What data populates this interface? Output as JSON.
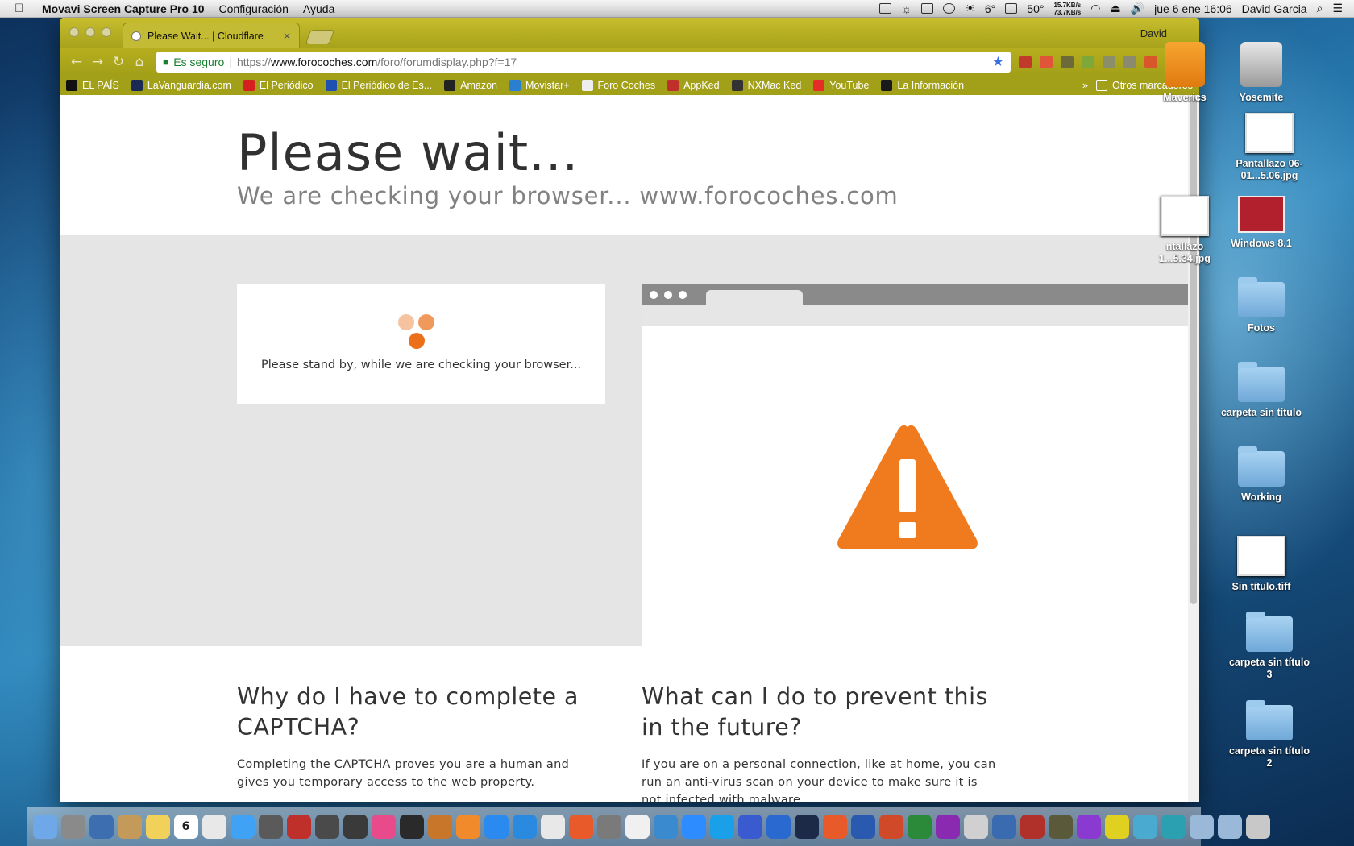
{
  "menubar": {
    "app_name": "Movavi Screen Capture Pro 10",
    "menus": [
      "Configuración",
      "Ayuda"
    ],
    "temperature": "6°",
    "cpu_temp": "50°",
    "net_up": "15.7KB/s",
    "net_down": "73.7KB/s",
    "datetime": "jue 6 ene  16:06",
    "user": "David Garcia"
  },
  "browser": {
    "tab_title": "Please Wait... | Cloudflare",
    "profile": "David",
    "security_label": "Es seguro",
    "url_scheme": "https://",
    "url_host": "www.forocoches.com",
    "url_path": "/foro/forumdisplay.php?f=17",
    "bookmarks": [
      {
        "label": "EL PAÍS",
        "color": "#111111"
      },
      {
        "label": "LaVanguardia.com",
        "color": "#1b2a55"
      },
      {
        "label": "El Periódico",
        "color": "#d62020"
      },
      {
        "label": "El Periódico de Es...",
        "color": "#1f4fb0"
      },
      {
        "label": "Amazon",
        "color": "#222222"
      },
      {
        "label": "Movistar+",
        "color": "#2a7fd0"
      },
      {
        "label": "Foro Coches",
        "color": "#eeeeee"
      },
      {
        "label": "AppKed",
        "color": "#c0302a"
      },
      {
        "label": "NXMac Ked",
        "color": "#333333"
      },
      {
        "label": "YouTube",
        "color": "#e52d27"
      },
      {
        "label": "La Información",
        "color": "#1a1a1a"
      }
    ],
    "other_bookmarks": "Otros marcadores"
  },
  "page": {
    "title": "Please wait...",
    "subtitle": "We are checking your browser... www.forocoches.com",
    "standby_message": "Please stand by, while we are checking your browser...",
    "why_heading": "Why do I have to complete a CAPTCHA?",
    "why_text": "Completing the CAPTCHA proves you are a human and gives you temporary access to the web property.",
    "prevent_heading": "What can I do to prevent this in the future?",
    "prevent_text": "If you are on a personal connection, like at home, you can run an anti-virus scan on your device to make sure it is not infected with malware.",
    "accent_color": "#ef7b1e"
  },
  "desktop_icons": [
    {
      "label": "Maverics",
      "icon": "usb-drive-icon"
    },
    {
      "label": "Yosemite",
      "icon": "hard-drive-icon"
    },
    {
      "label": "Pantallazo 06-01...5.06.jpg",
      "icon": "image-file-icon"
    },
    {
      "label": "ntallazo 1...5.34.jpg",
      "icon": "image-file-icon"
    },
    {
      "label": "Windows 8.1",
      "icon": "parallels-vm-icon"
    },
    {
      "label": "Fotos",
      "icon": "folder-icon"
    },
    {
      "label": "carpeta sin título",
      "icon": "folder-icon"
    },
    {
      "label": "Working",
      "icon": "folder-icon"
    },
    {
      "label": "Sin título.tiff",
      "icon": "image-file-icon"
    },
    {
      "label": "carpeta sin título 3",
      "icon": "folder-icon"
    },
    {
      "label": "carpeta sin título 2",
      "icon": "folder-icon"
    }
  ],
  "dock": {
    "calendar_day": "6",
    "apps": [
      "finder",
      "launchpad",
      "preview",
      "contacts",
      "notes",
      "calendar",
      "photos",
      "messages",
      "facetime",
      "photo-booth",
      "image-capture",
      "final-cut",
      "itunes",
      "imovie",
      "garageband",
      "ibooks",
      "app-store",
      "safari",
      "chrome",
      "firefox",
      "system-preferences",
      "textedit",
      "xcode-tool",
      "zoom",
      "skype",
      "vpn",
      "x-app",
      "photoshop",
      "windows",
      "word",
      "powerpoint",
      "excel",
      "affinity",
      "compressor",
      "scanner",
      "game",
      "movie-app",
      "affinity-photo",
      "chrome-2",
      "mail",
      "movavi",
      "downloads",
      "documents",
      "trash"
    ]
  }
}
